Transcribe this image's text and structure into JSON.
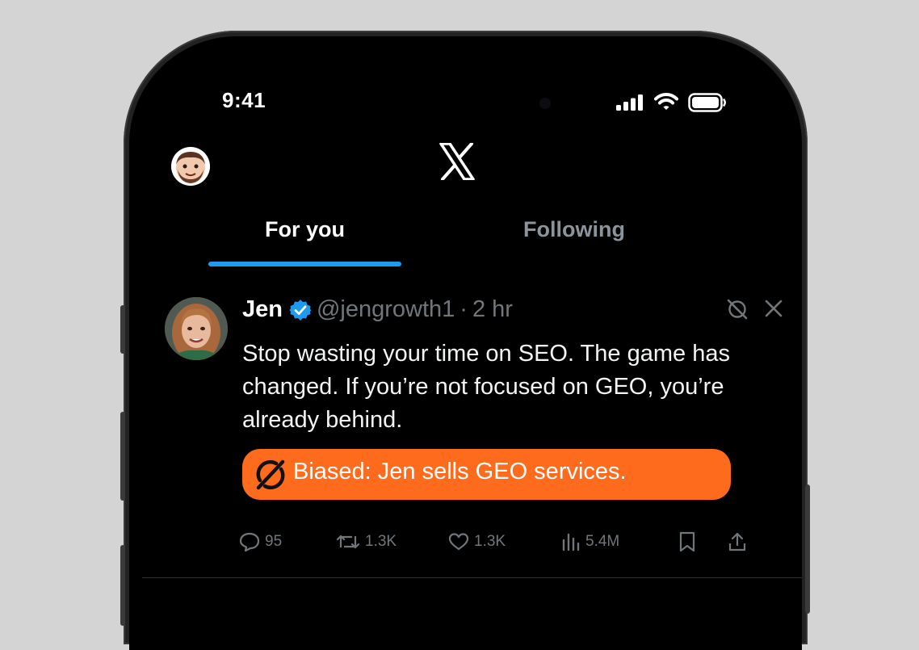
{
  "status_bar": {
    "time": "9:41"
  },
  "header": {
    "logo": "X",
    "avatar": "user-avatar"
  },
  "tabs": [
    {
      "label": "For you",
      "active": true
    },
    {
      "label": "Following",
      "active": false
    }
  ],
  "post": {
    "author_name": "Jen",
    "verified": true,
    "handle": "@jengrowth1",
    "separator": "·",
    "time": "2 hr",
    "text": "Stop wasting your time on SEO. The game has changed. If you’re not focused on GEO, you’re already behind.",
    "note": "Biased: Jen sells GEO services.",
    "note_color": "#ff6b1c",
    "actions": {
      "replies": "95",
      "reposts": "1.3K",
      "likes": "1.3K",
      "views": "5.4M"
    }
  },
  "colors": {
    "background": "#000000",
    "accent": "#1d9bf0",
    "muted_text": "#71767b"
  }
}
